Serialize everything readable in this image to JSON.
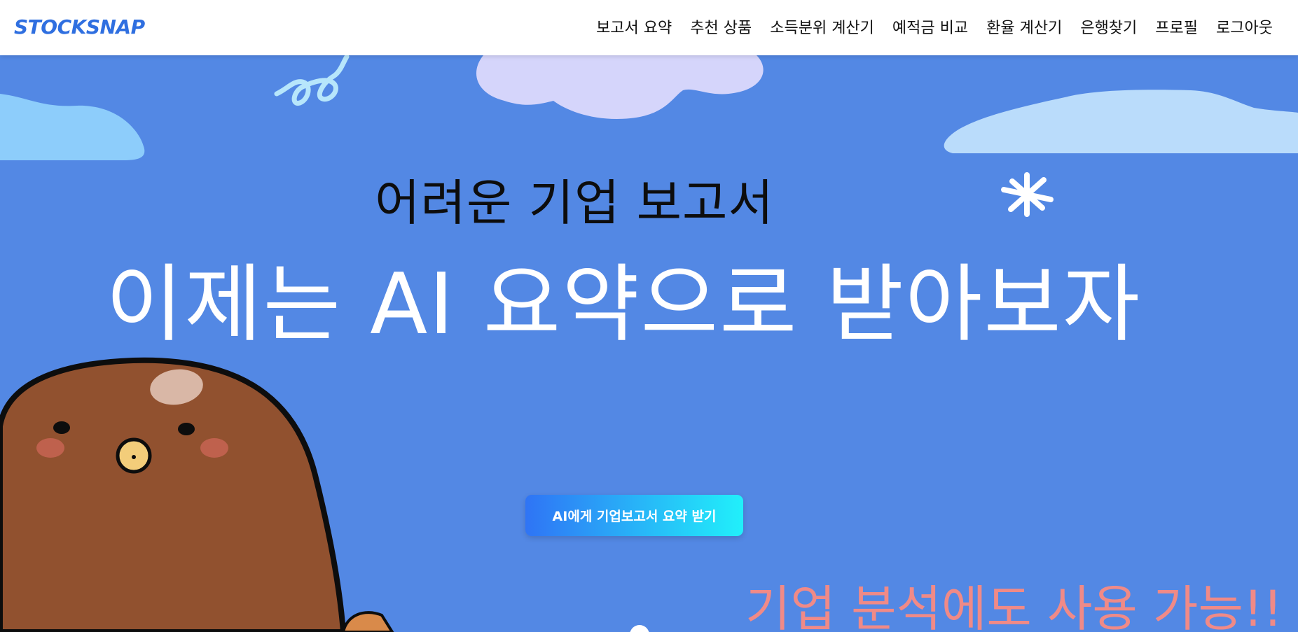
{
  "navbar": {
    "brand": "STOCKSNAP",
    "links": [
      {
        "label": "보고서 요약"
      },
      {
        "label": "추천 상품"
      },
      {
        "label": "소득분위 계산기"
      },
      {
        "label": "예적금 비교"
      },
      {
        "label": "환율 계산기"
      },
      {
        "label": "은행찾기"
      },
      {
        "label": "프로필"
      },
      {
        "label": "로그아웃"
      }
    ]
  },
  "hero": {
    "headline_top": "어려운 기업 보고서",
    "headline_main": "이제는 AI 요약으로 받아보자",
    "cta_label": "AI에게 기업보고서 요약 받기",
    "sub_headline": "기업 분석에도 사용 가능!!"
  },
  "colors": {
    "brand": "#2f6fe0",
    "hero_background": "#5388e4",
    "cta_gradient_start": "#2f74f5",
    "cta_gradient_end": "#21f0fa",
    "sub_headline": "#f08a87",
    "mascot": "#91512f"
  },
  "icons": [
    "cloud-icon",
    "squiggle-icon",
    "sparkle-icon",
    "mascot-illustration"
  ]
}
